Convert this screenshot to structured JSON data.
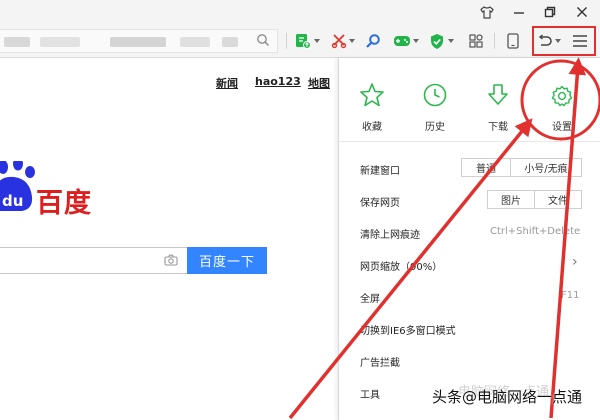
{
  "window": {
    "skin_icon": "tshirt-icon",
    "minimize_icon": "minimize-icon",
    "restore_icon": "restore-icon",
    "close_icon": "close-icon"
  },
  "toolbar": {
    "icons": [
      "search-icon",
      "upload-icon",
      "scissors-icon",
      "find-icon",
      "gamepad-icon",
      "shield-icon",
      "apps-grid-icon",
      "tablet-icon",
      "undo-icon",
      "menu-icon"
    ],
    "accent": "#24b24b"
  },
  "page": {
    "links": [
      "新闻",
      "hao123",
      "地图"
    ],
    "logo_text": "百度",
    "logo_paw_text": "du",
    "search_button": "百度一下",
    "brand_color": "#de1f1f",
    "button_color": "#3385ff"
  },
  "menu": {
    "big_buttons": [
      {
        "label": "收藏",
        "icon": "star-icon"
      },
      {
        "label": "历史",
        "icon": "clock-icon"
      },
      {
        "label": "下载",
        "icon": "download-icon"
      },
      {
        "label": "设置",
        "icon": "gear-icon"
      }
    ],
    "rows": {
      "new_window": {
        "label": "新建窗口",
        "opt1": "普通",
        "opt2": "小号/无痕"
      },
      "save_page": {
        "label": "保存网页",
        "opt1": "图片",
        "opt2": "文件"
      },
      "clear_traces": {
        "label": "清除上网痕迹",
        "shortcut": "Ctrl+Shift+Delete"
      },
      "zoom": {
        "label": "网页缩放（90%）",
        "arrow": "›"
      },
      "fullscreen": {
        "label": "全屏",
        "shortcut": "F11"
      },
      "ie6_mode": {
        "label": "切换到IE6多窗口模式"
      },
      "ad_block": {
        "label": "广告拦截"
      },
      "tools": {
        "label": "工具"
      }
    },
    "icon_color": "#2db84d"
  },
  "annotation": {
    "watermark": "头条@电脑网络一点通",
    "faint_watermark": "电脑网络一点通",
    "highlight_color": "#e0312f"
  }
}
